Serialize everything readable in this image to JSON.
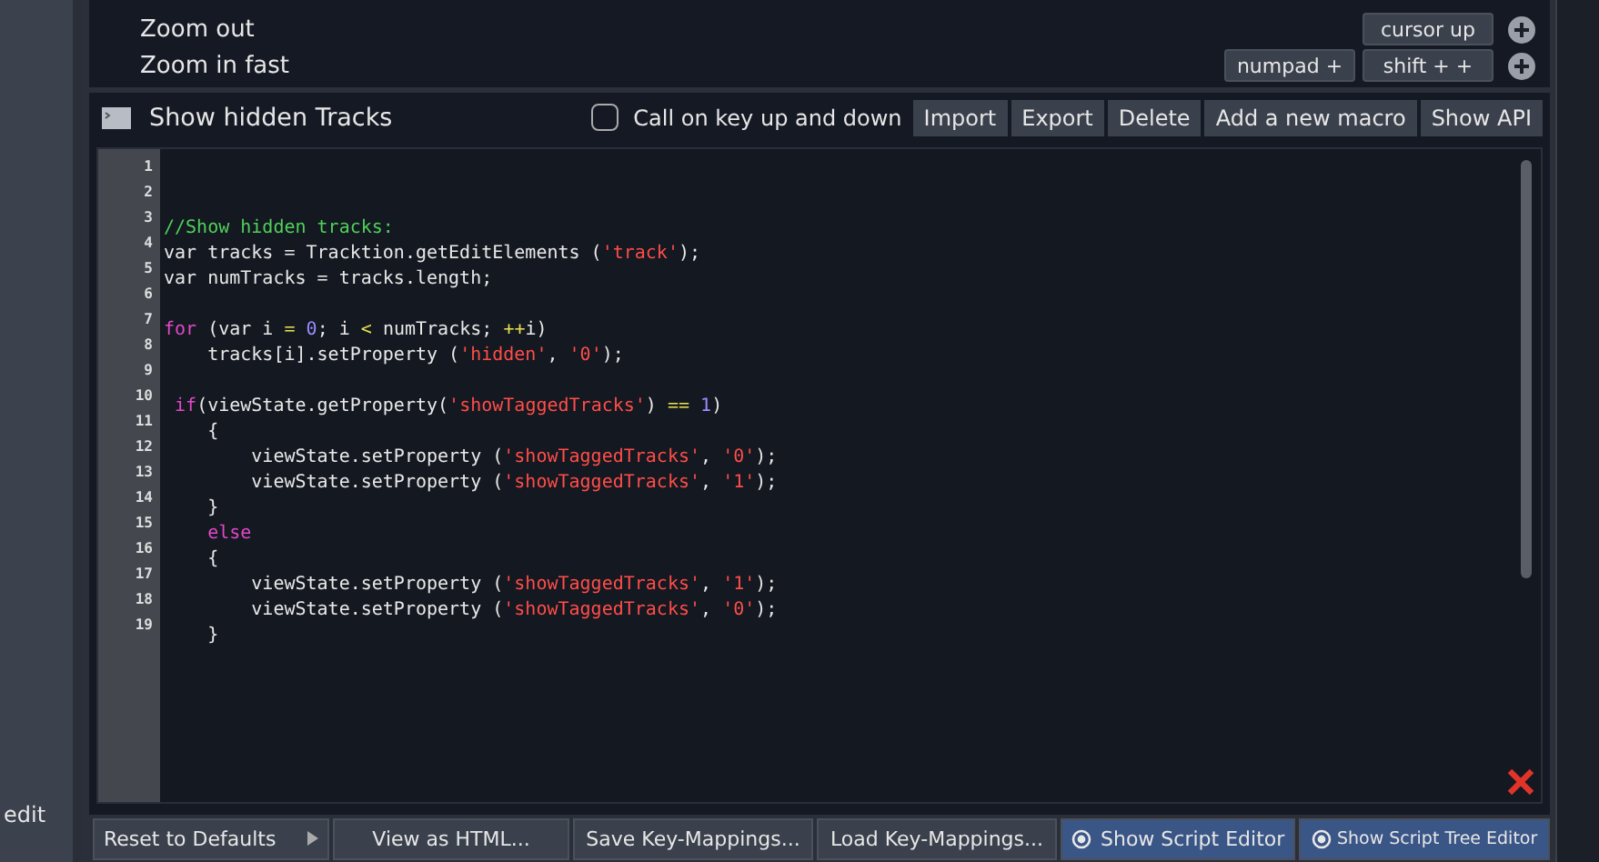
{
  "shortcuts": [
    {
      "label": "Zoom out",
      "keys": [
        "cursor up"
      ]
    },
    {
      "label": "Zoom in fast",
      "keys": [
        "numpad +",
        "shift + +"
      ]
    }
  ],
  "macro": {
    "title": "Show hidden Tracks",
    "call_on_key": {
      "label": "Call on key up and down",
      "checked": false
    },
    "buttons": [
      "Import",
      "Export",
      "Delete",
      "Add a new macro",
      "Show API"
    ]
  },
  "code": [
    {
      "number": "1"
    },
    {
      "number": "2"
    },
    {
      "number": "3",
      "segments": [
        {
          "text": "//Show hidden tracks:",
          "color": "#4fd05a"
        }
      ]
    },
    {
      "number": "4",
      "segments": [
        {
          "text": "var tracks = Tracktion.getEditElements (",
          "color": "#e8e8e8"
        },
        {
          "text": "'track'",
          "color": "#ff4d4a"
        },
        {
          "text": ");",
          "color": "#e8e8e8"
        }
      ]
    },
    {
      "number": "5",
      "segments": [
        {
          "text": "var numTracks = tracks.length;",
          "color": "#e8e8e8"
        }
      ]
    },
    {
      "number": "6"
    },
    {
      "number": "7",
      "segments": [
        {
          "text": "for",
          "color": "#e048c8"
        },
        {
          "text": " (var i ",
          "color": "#e8e8e8"
        },
        {
          "text": "=",
          "color": "#e8e050"
        },
        {
          "text": " 0",
          "color": "#9a8cff"
        },
        {
          "text": "; i ",
          "color": "#e8e8e8"
        },
        {
          "text": "<",
          "color": "#e8e050"
        },
        {
          "text": " numTracks; ",
          "color": "#e8e8e8"
        },
        {
          "text": "++",
          "color": "#e8e050"
        },
        {
          "text": "i)",
          "color": "#e8e8e8"
        }
      ]
    },
    {
      "number": "8",
      "segments": [
        {
          "text": "    tracks[i].setProperty (",
          "color": "#e8e8e8"
        },
        {
          "text": "'hidden'",
          "color": "#ff4d4a"
        },
        {
          "text": ", ",
          "color": "#e8e8e8"
        },
        {
          "text": "'0'",
          "color": "#ff4d4a"
        },
        {
          "text": ");",
          "color": "#e8e8e8"
        }
      ]
    },
    {
      "number": "9"
    },
    {
      "number": "10",
      "segments": [
        {
          "text": " if",
          "color": "#e048c8"
        },
        {
          "text": "(viewState.getProperty(",
          "color": "#e8e8e8"
        },
        {
          "text": "'showTaggedTracks'",
          "color": "#ff4d4a"
        },
        {
          "text": ") ",
          "color": "#e8e8e8"
        },
        {
          "text": "==",
          "color": "#e8e050"
        },
        {
          "text": " 1",
          "color": "#9a8cff"
        },
        {
          "text": ")",
          "color": "#e8e8e8"
        }
      ]
    },
    {
      "number": "11",
      "segments": [
        {
          "text": "    {",
          "color": "#e8e8e8"
        }
      ]
    },
    {
      "number": "12",
      "segments": [
        {
          "text": "        viewState.setProperty (",
          "color": "#e8e8e8"
        },
        {
          "text": "'showTaggedTracks'",
          "color": "#ff4d4a"
        },
        {
          "text": ", ",
          "color": "#e8e8e8"
        },
        {
          "text": "'0'",
          "color": "#ff4d4a"
        },
        {
          "text": ");",
          "color": "#e8e8e8"
        }
      ]
    },
    {
      "number": "13",
      "segments": [
        {
          "text": "        viewState.setProperty (",
          "color": "#e8e8e8"
        },
        {
          "text": "'showTaggedTracks'",
          "color": "#ff4d4a"
        },
        {
          "text": ", ",
          "color": "#e8e8e8"
        },
        {
          "text": "'1'",
          "color": "#ff4d4a"
        },
        {
          "text": ");",
          "color": "#e8e8e8"
        }
      ]
    },
    {
      "number": "14",
      "segments": [
        {
          "text": "    }",
          "color": "#e8e8e8"
        }
      ]
    },
    {
      "number": "15",
      "segments": [
        {
          "text": "    else",
          "color": "#e048c8"
        }
      ]
    },
    {
      "number": "16",
      "segments": [
        {
          "text": "    {",
          "color": "#e8e8e8"
        }
      ]
    },
    {
      "number": "17",
      "segments": [
        {
          "text": "        viewState.setProperty (",
          "color": "#e8e8e8"
        },
        {
          "text": "'showTaggedTracks'",
          "color": "#ff4d4a"
        },
        {
          "text": ", ",
          "color": "#e8e8e8"
        },
        {
          "text": "'1'",
          "color": "#ff4d4a"
        },
        {
          "text": ");",
          "color": "#e8e8e8"
        }
      ]
    },
    {
      "number": "18",
      "segments": [
        {
          "text": "        viewState.setProperty (",
          "color": "#e8e8e8"
        },
        {
          "text": "'showTaggedTracks'",
          "color": "#ff4d4a"
        },
        {
          "text": ", ",
          "color": "#e8e8e8"
        },
        {
          "text": "'0'",
          "color": "#ff4d4a"
        },
        {
          "text": ");",
          "color": "#e8e8e8"
        }
      ]
    },
    {
      "number": "19",
      "segments": [
        {
          "text": "    }",
          "color": "#e8e8e8"
        }
      ]
    }
  ],
  "sidebar": {
    "label": "edit"
  },
  "bottom_buttons": [
    {
      "kind": "menu",
      "label": "Reset to Defaults"
    },
    {
      "kind": "plain",
      "label": "View as HTML..."
    },
    {
      "kind": "plain",
      "label": "Save Key-Mappings..."
    },
    {
      "kind": "plain",
      "label": "Load Key-Mappings..."
    },
    {
      "kind": "toggle",
      "label": "Show Script Editor",
      "on": true
    },
    {
      "kind": "toggle",
      "label": "Show Script Tree Editor",
      "on": true
    }
  ]
}
